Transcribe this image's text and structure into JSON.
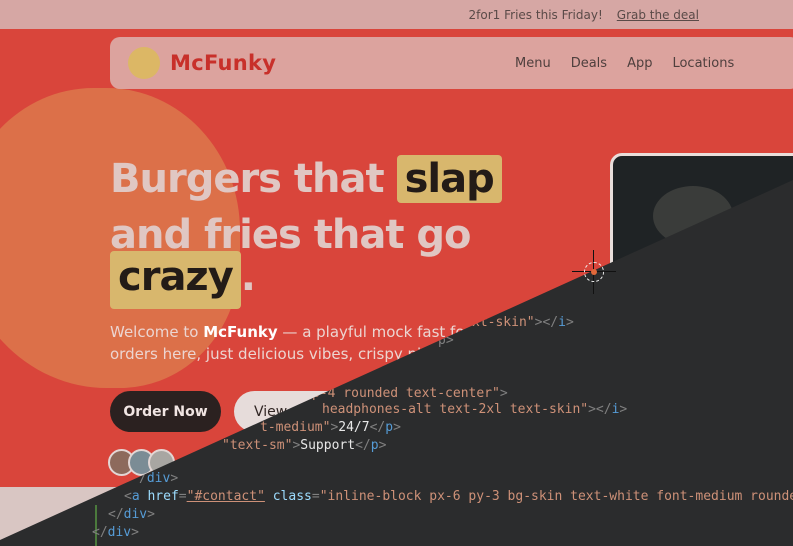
{
  "promo": {
    "text": "2for1 Fries this Friday!",
    "link": "Grab the deal"
  },
  "brand": {
    "name": "McFunky",
    "accent": "#c8302a",
    "background": "#d9453b"
  },
  "nav": {
    "items": [
      "Menu",
      "Deals",
      "App",
      "Locations"
    ]
  },
  "hero": {
    "line1_plain": "Burgers that ",
    "line1_chip": "slap",
    "line2": "and fries that go",
    "line3_chip": "crazy",
    "line3_end": ".",
    "desc_prefix": "Welcome to ",
    "desc_brand": "McFunky",
    "desc_rest": " — a playful mock fast foo",
    "desc_line2": "orders here, just delicious vibes, crispy pi",
    "order_button": "Order Now",
    "view_button": "View"
  },
  "editor": {
    "lines": [
      {
        "parts": [
          [
            "str",
            "xt-skin\""
          ],
          [
            "pn",
            "></"
          ],
          [
            "tag",
            "i"
          ],
          [
            "pn",
            ">"
          ]
        ]
      },
      {
        "parts": [
          [
            "pn",
            "p>"
          ]
        ]
      },
      {
        "parts": [
          [
            "str",
            "p-4 rounded text-center\""
          ],
          [
            "pn",
            ">"
          ]
        ]
      },
      {
        "parts": [
          [
            "str",
            "headphones-alt text-2xl text-skin\""
          ],
          [
            "pn",
            "></"
          ],
          [
            "tag",
            "i"
          ],
          [
            "pn",
            ">"
          ]
        ]
      },
      {
        "parts": [
          [
            "str",
            "t-medium\""
          ],
          [
            "pn",
            ">"
          ],
          [
            "tx",
            "24/7"
          ],
          [
            "pn",
            "</"
          ],
          [
            "tag",
            "p"
          ],
          [
            "pn",
            ">"
          ]
        ]
      },
      {
        "parts": [
          [
            "str",
            "\"text-sm\""
          ],
          [
            "pn",
            ">"
          ],
          [
            "tx",
            "Support"
          ],
          [
            "pn",
            "</"
          ],
          [
            "tag",
            "p"
          ],
          [
            "pn",
            ">"
          ]
        ]
      },
      {
        "parts": [
          [
            "pn",
            "/"
          ],
          [
            "tag",
            "div"
          ],
          [
            "pn",
            ">"
          ]
        ]
      },
      {
        "parts": [
          [
            "pn",
            "<"
          ],
          [
            "tag",
            "a"
          ],
          [
            "tx",
            " "
          ],
          [
            "attr",
            "href"
          ],
          [
            "pn",
            "="
          ],
          [
            "hx",
            "\"#contact\""
          ],
          [
            "tx",
            " "
          ],
          [
            "attr",
            "class"
          ],
          [
            "pn",
            "="
          ],
          [
            "str",
            "\"inline-block px-6 py-3 bg-skin text-white font-medium rounded"
          ]
        ]
      },
      {
        "parts": [
          [
            "pn",
            "</"
          ],
          [
            "tag",
            "div"
          ],
          [
            "pn",
            ">"
          ]
        ]
      },
      {
        "parts": [
          [
            "pn",
            "</"
          ],
          [
            "tag",
            "div"
          ],
          [
            "pn",
            ">"
          ]
        ]
      }
    ]
  },
  "colors": {
    "chip": "#d8b76d",
    "editor_bg": "#2b2c2d"
  }
}
